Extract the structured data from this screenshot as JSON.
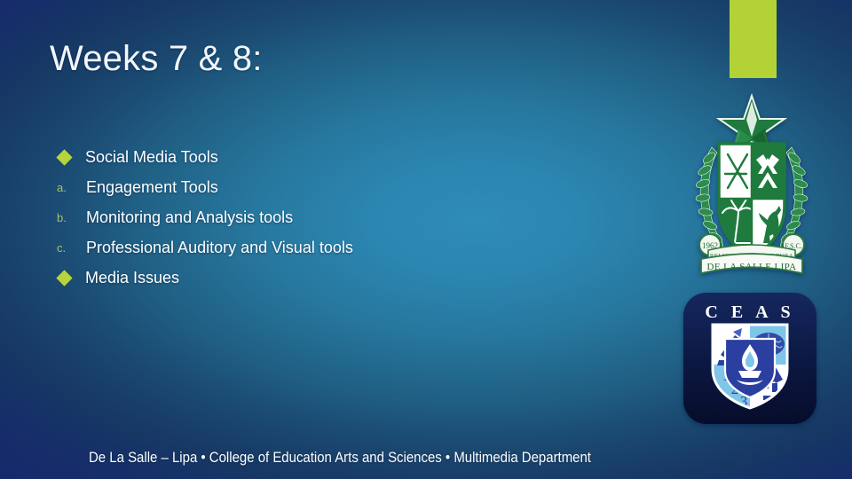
{
  "slide": {
    "title": "Weeks 7 & 8:",
    "accent_green": "#b3d236",
    "bullet_green": "#b5d43d",
    "background_dark": "#1b3878",
    "background_light": "#2f8cb6",
    "text_color": "#ffffff"
  },
  "bullets": [
    {
      "marker_type": "diamond",
      "marker": "",
      "level": 1,
      "label": "Social Media Tools"
    },
    {
      "marker_type": "letter",
      "marker": "a.",
      "level": 2,
      "label": "Engagement Tools"
    },
    {
      "marker_type": "letter",
      "marker": "b.",
      "level": 2,
      "label": "Monitoring and Analysis tools"
    },
    {
      "marker_type": "letter",
      "marker": "c.",
      "level": 2,
      "label": "Professional Auditory and Visual tools"
    },
    {
      "marker_type": "diamond",
      "marker": "",
      "level": 1,
      "label": "Media Issues"
    }
  ],
  "footer": {
    "text": "De La Salle – Lipa • College of Education Arts and Sciences • Multimedia Department"
  },
  "crest": {
    "name": "de-la-salle-lipa-crest",
    "year": "1962",
    "order": "F.S.C.",
    "motto": "RELIGIO MORES CULTURA",
    "banner": "DE LA SALLE LIPA"
  },
  "ceas_logo": {
    "name": "ceas-logo",
    "letters": "C E A S",
    "numbers": "123"
  }
}
